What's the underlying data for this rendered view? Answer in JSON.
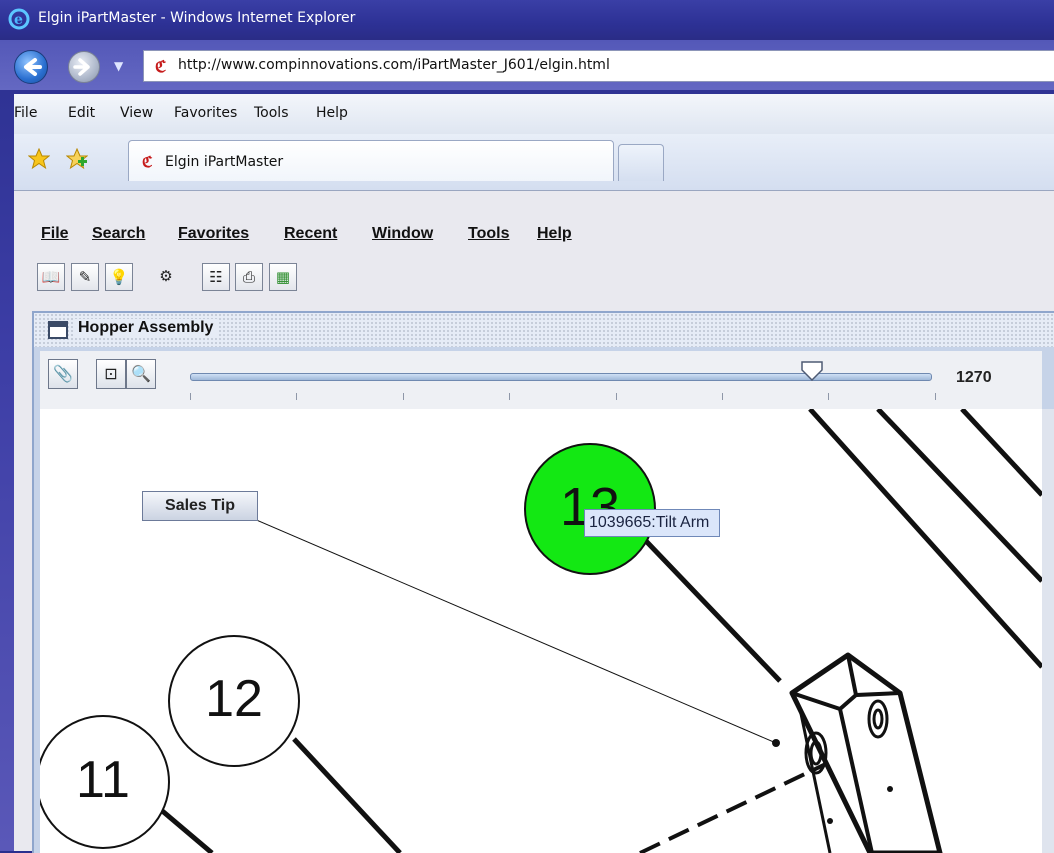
{
  "browser": {
    "window_title": "Elgin iPartMaster - Windows Internet Explorer",
    "url": "http://www.compinnovations.com/iPartMaster_J601/elgin.html",
    "menu": [
      "File",
      "Edit",
      "View",
      "Favorites",
      "Tools",
      "Help"
    ],
    "tab_title": "Elgin iPartMaster",
    "icons": [
      "ie-logo-icon",
      "back-arrow-icon",
      "forward-arrow-icon",
      "favorites-star-icon",
      "add-favorites-icon"
    ]
  },
  "app": {
    "menu": [
      "File",
      "Search",
      "Favorites",
      "Recent",
      "Window",
      "Tools",
      "Help"
    ],
    "toolbar": [
      {
        "icon": "book-icon",
        "glyph": "📖"
      },
      {
        "icon": "edit-icon",
        "glyph": "✎"
      },
      {
        "icon": "tip-bulb-icon",
        "glyph": "💡"
      },
      {
        "icon": "parts-icon",
        "glyph": "⚙"
      },
      {
        "icon": "checklist-icon",
        "glyph": "☷"
      },
      {
        "icon": "print-icon",
        "glyph": "⎙"
      },
      {
        "icon": "image-icon",
        "glyph": "▦"
      }
    ]
  },
  "viewer": {
    "title": "Hopper Assembly",
    "zoom_value": "1270",
    "zoom_fraction": 0.84,
    "tools": [
      {
        "icon": "paperclip-icon",
        "glyph": "📎"
      },
      {
        "icon": "zoom-box-icon",
        "glyph": "⊡"
      },
      {
        "icon": "zoom-icon",
        "glyph": "🔍"
      }
    ],
    "sales_tip_label": "Sales Tip",
    "tooltip_text": "1039665:Tilt Arm",
    "callouts": [
      {
        "label": "13",
        "highlighted": true,
        "color": "#13e813"
      },
      {
        "label": "12",
        "highlighted": false
      },
      {
        "label": "11",
        "highlighted": false
      }
    ]
  }
}
